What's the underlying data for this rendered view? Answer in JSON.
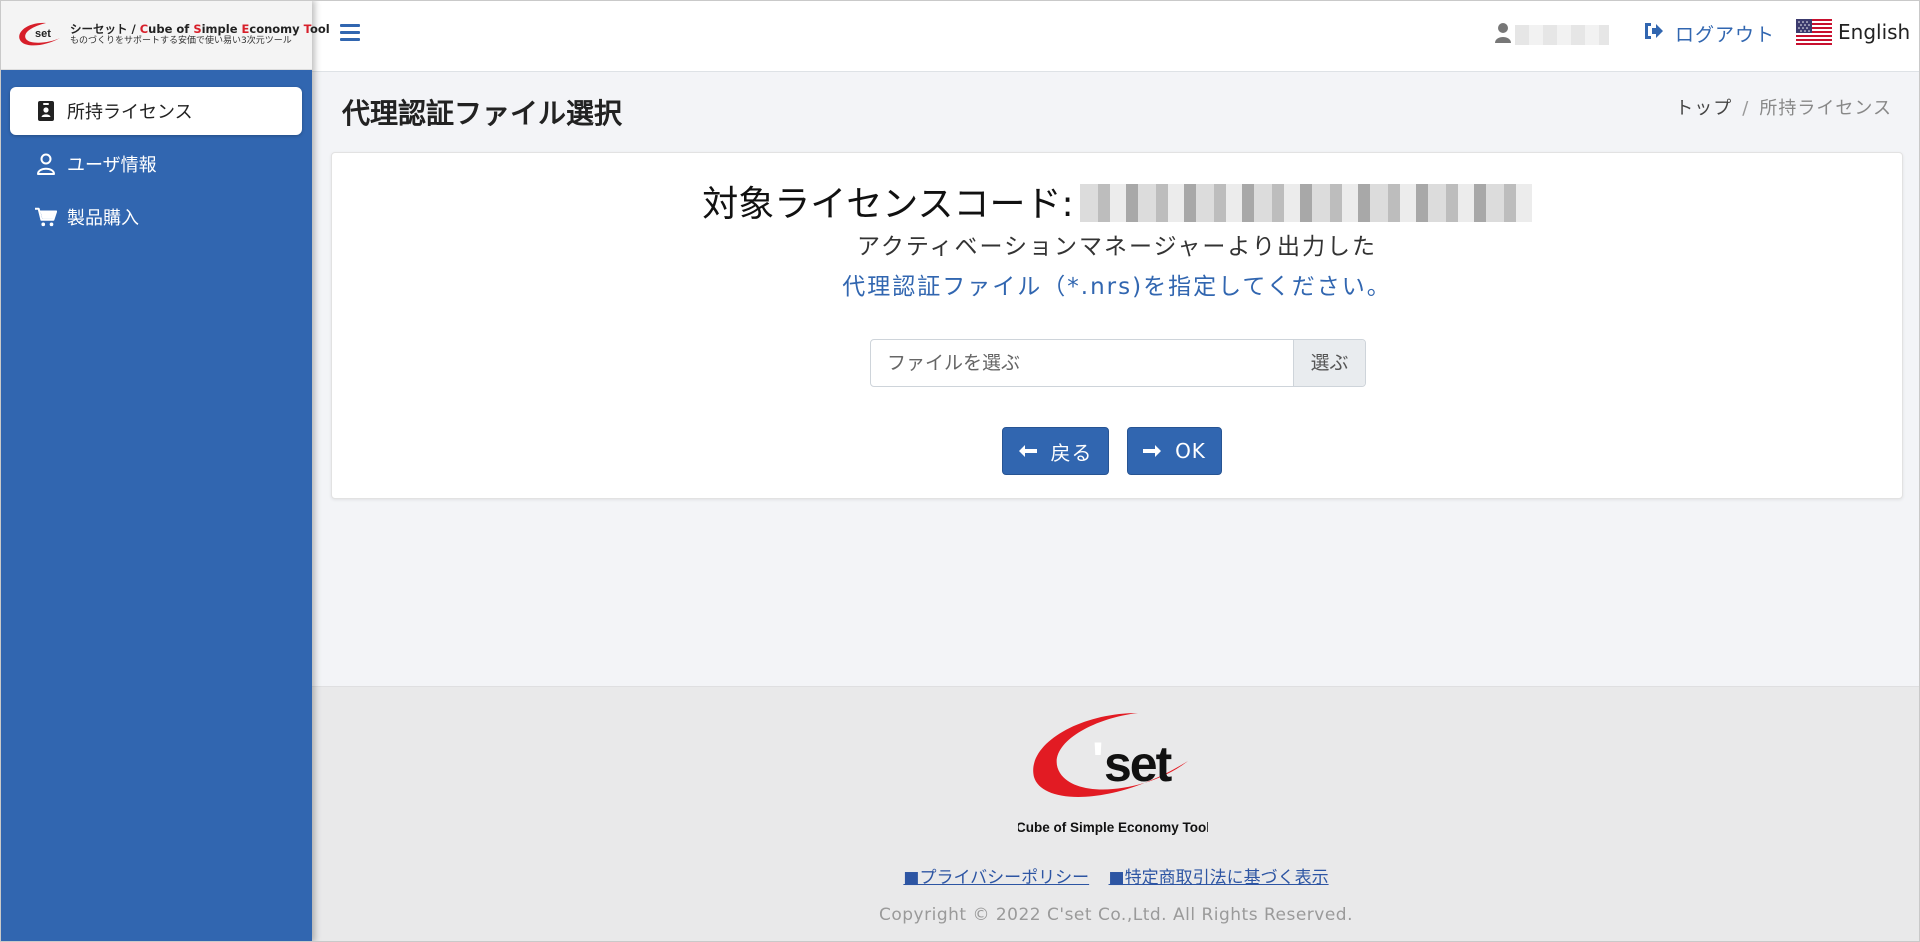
{
  "brand": {
    "title_prefix": "シーセット / ",
    "title_parts": [
      {
        "text": "C",
        "red": true
      },
      {
        "text": "ube of ",
        "red": false
      },
      {
        "text": "S",
        "red": true
      },
      {
        "text": "imple ",
        "red": false
      },
      {
        "text": "E",
        "red": true
      },
      {
        "text": "conomy ",
        "red": false
      },
      {
        "text": "T",
        "red": true
      },
      {
        "text": "ool",
        "red": false
      }
    ],
    "subtitle": "ものづくりをサポートする安価で使い易い3次元ツール",
    "logo_mark": "set",
    "red": "#d71f2a"
  },
  "sidebar": {
    "items": [
      {
        "label": "所持ライセンス",
        "icon": "id-badge-icon",
        "active": true
      },
      {
        "label": "ユーザ情報",
        "icon": "user-icon",
        "active": false
      },
      {
        "label": "製品購入",
        "icon": "cart-icon",
        "active": false
      }
    ]
  },
  "topbar": {
    "logout_label": "ログアウト",
    "language_label": "English"
  },
  "page": {
    "title": "代理認証ファイル選択",
    "breadcrumb": [
      "トップ",
      "所持ライセンス"
    ]
  },
  "card": {
    "license_label": "対象ライセンスコード:",
    "instruction_line1": "アクティベーションマネージャーより出力した",
    "instruction_line2": "代理認証ファイル（*.nrs)を指定してください。",
    "file_placeholder": "ファイルを選ぶ",
    "browse_label": "選ぶ",
    "back_label": "戻る",
    "ok_label": "OK"
  },
  "footer": {
    "logo_tagline": "Cube of Simple Economy Tool",
    "logo_mark": "set",
    "links": [
      "■プライバシーポリシー",
      "■特定商取引法に基づく表示"
    ],
    "copyright": "Copyright © 2022 C'set Co.,Ltd. All Rights Reserved."
  },
  "colors": {
    "sidebar": "#3166b0",
    "accent": "#3166b0",
    "logo_red": "#e21b23"
  }
}
